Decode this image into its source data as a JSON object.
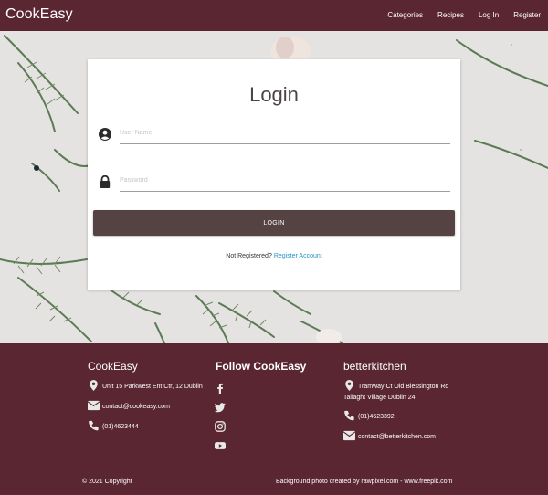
{
  "navbar": {
    "brand": "CookEasy",
    "links": [
      "Categories",
      "Recipes",
      "Log In",
      "Register"
    ]
  },
  "login": {
    "title": "Login",
    "username_placeholder": "User Name",
    "password_placeholder": "Password",
    "button_label": "LOGIN",
    "not_registered": "Not Registered?",
    "register_link": "Register Account"
  },
  "footer": {
    "col1": {
      "heading": "CookEasy",
      "address": "Unit 15 Parkwest Ent Ctr, 12 Dublin",
      "email": "contact@cookeasy.com",
      "phone": "(01)4623444"
    },
    "col2": {
      "heading": "Follow CookEasy",
      "icons": [
        "facebook-icon",
        "twitter-icon",
        "instagram-icon",
        "youtube-icon"
      ]
    },
    "col3": {
      "heading": "betterkitchen",
      "address_line1": "Tramway Ct Old Blessington Rd",
      "address_line2": "Tallaght Village Dublin 24",
      "phone": "(01)4623392",
      "email": "contact@betterkitchen.com"
    },
    "copyright": "© 2021 Copyright",
    "credit": "Background photo created by rawpixel.com - www.freepik.com"
  },
  "colors": {
    "brand": "#5a2632",
    "button": "#554343",
    "link": "#2196c4",
    "hero_bg": "#e5e3e1"
  }
}
